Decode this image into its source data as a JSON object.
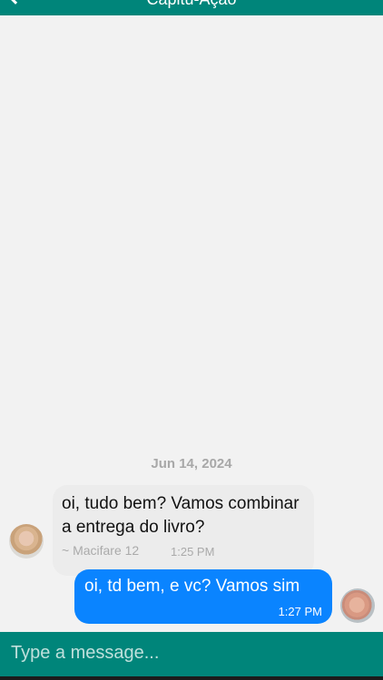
{
  "header": {
    "back_icon": "chevron-left-icon",
    "title": "Capitu-Ação"
  },
  "chat": {
    "date_separator": "Jun 14, 2024",
    "messages": [
      {
        "direction": "incoming",
        "text": "oi, tudo bem? Vamos combinar a entrega do livro?",
        "sender": "~ Macifare 12",
        "time": "1:25 PM"
      },
      {
        "direction": "outgoing",
        "text": "oi, td bem, e vc? Vamos sim",
        "time": "1:27 PM"
      }
    ]
  },
  "composer": {
    "placeholder": "Type a message...",
    "value": ""
  },
  "colors": {
    "header_bg": "#00857a",
    "outgoing_bubble": "#0a84ff",
    "incoming_bubble": "#ececec",
    "background": "#f2f2f2"
  }
}
